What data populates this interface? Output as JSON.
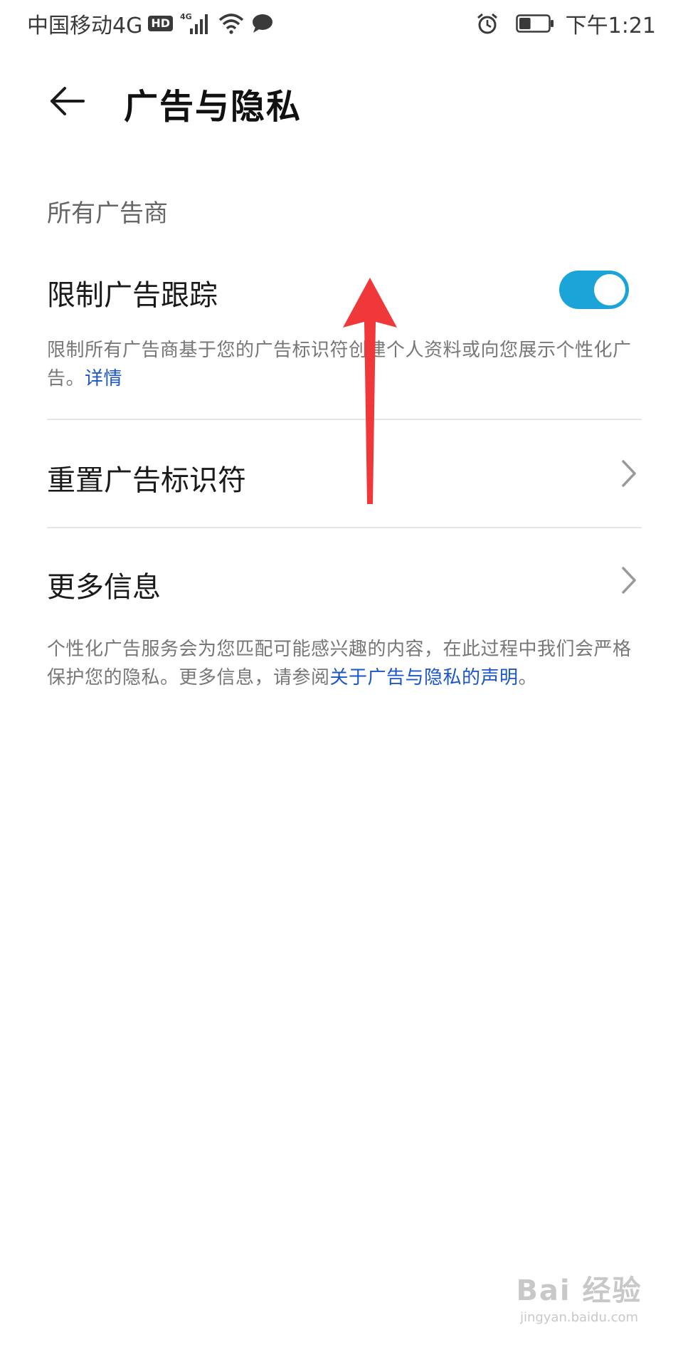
{
  "status_bar": {
    "carrier": "中国移动4G",
    "hd_badge": "HD",
    "network_label": "4G",
    "time": "下午1:21",
    "icons": [
      "hd-badge",
      "signal-icon",
      "wifi-icon",
      "message-icon",
      "alarm-icon",
      "battery-icon"
    ],
    "battery_level_percent": 40
  },
  "header": {
    "back_icon": "arrow-left-icon",
    "title": "广告与隐私"
  },
  "section": {
    "title": "所有广告商"
  },
  "limit_tracking": {
    "label": "限制广告跟踪",
    "toggle_on": true,
    "toggle_color": "#1aa4d8",
    "description": "限制所有广告商基于您的广告标识符创建个人资料或向您展示个性化广告。",
    "details_link": "详情"
  },
  "reset_id": {
    "label": "重置广告标识符",
    "icon": "chevron-right-icon"
  },
  "more_info": {
    "label": "更多信息",
    "icon": "chevron-right-icon"
  },
  "footer": {
    "text": "个性化广告服务会为您匹配可能感兴趣的内容，在此过程中我们会严格保护您的隐私。更多信息，请参阅",
    "link": "关于广告与隐私的声明",
    "end": "。"
  },
  "annotation": {
    "icon": "red-arrow-up-icon",
    "color": "#f0383a"
  },
  "watermark": {
    "brand": "Bai 经验",
    "site": "jingyan.baidu.com"
  },
  "colors": {
    "link": "#1a56c8",
    "divider": "#e6e6e6"
  }
}
